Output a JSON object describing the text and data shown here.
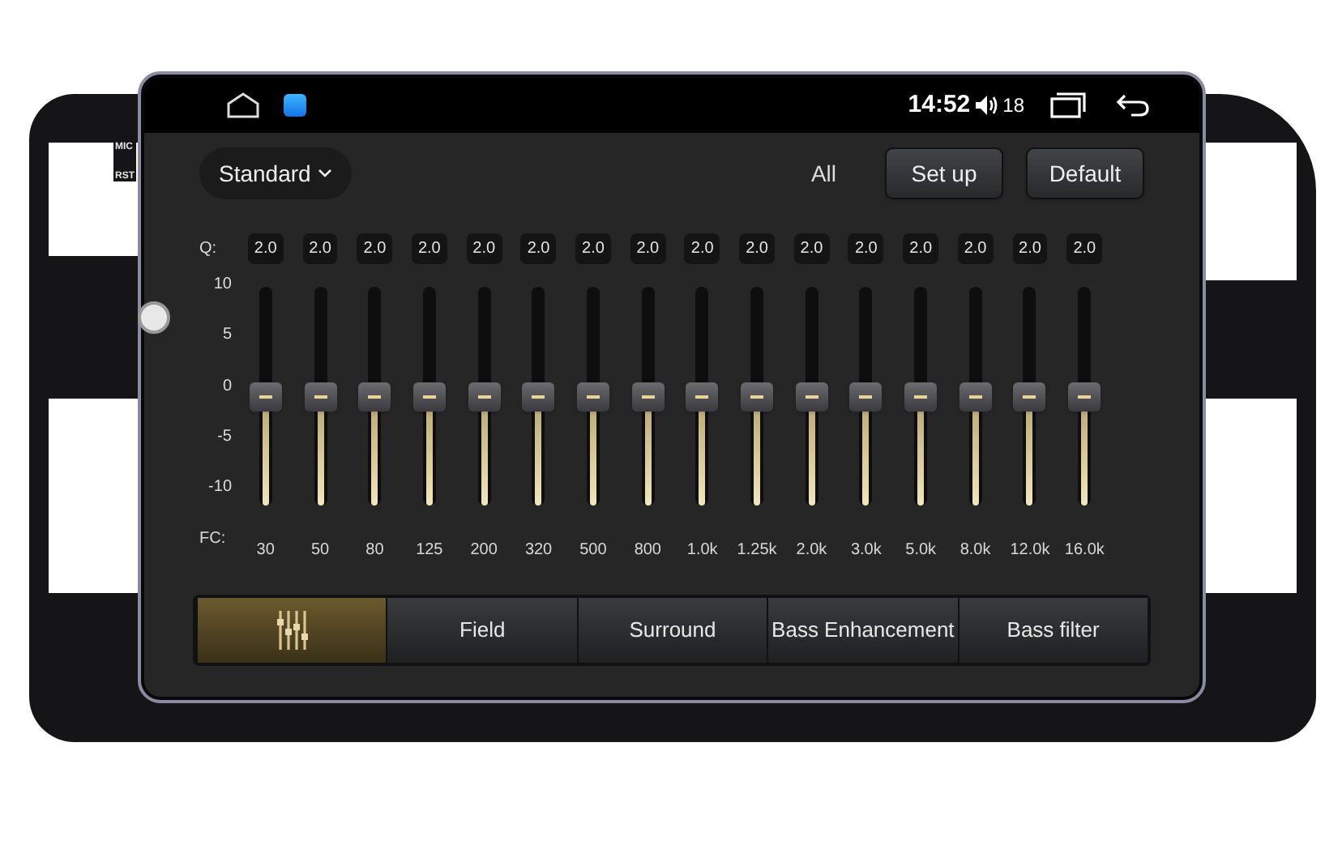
{
  "bezel": {
    "labels": [
      "MIC",
      "RST"
    ]
  },
  "status_bar": {
    "time": "14:52",
    "volume": "18"
  },
  "toolbar": {
    "preset": "Standard",
    "scope": "All",
    "buttons": [
      "Set up",
      "Default"
    ]
  },
  "equalizer": {
    "q_label": "Q:",
    "fc_label": "FC:",
    "scale": [
      "10",
      "5",
      "0",
      "-5",
      "-10"
    ],
    "bands": [
      {
        "q": "2.0",
        "fc": "30",
        "level": 0.5
      },
      {
        "q": "2.0",
        "fc": "50",
        "level": 0.5
      },
      {
        "q": "2.0",
        "fc": "80",
        "level": 0.5
      },
      {
        "q": "2.0",
        "fc": "125",
        "level": 0.5
      },
      {
        "q": "2.0",
        "fc": "200",
        "level": 0.5
      },
      {
        "q": "2.0",
        "fc": "320",
        "level": 0.5
      },
      {
        "q": "2.0",
        "fc": "500",
        "level": 0.5
      },
      {
        "q": "2.0",
        "fc": "800",
        "level": 0.5
      },
      {
        "q": "2.0",
        "fc": "1.0k",
        "level": 0.5
      },
      {
        "q": "2.0",
        "fc": "1.25k",
        "level": 0.5
      },
      {
        "q": "2.0",
        "fc": "2.0k",
        "level": 0.5
      },
      {
        "q": "2.0",
        "fc": "3.0k",
        "level": 0.5
      },
      {
        "q": "2.0",
        "fc": "5.0k",
        "level": 0.5
      },
      {
        "q": "2.0",
        "fc": "8.0k",
        "level": 0.5
      },
      {
        "q": "2.0",
        "fc": "12.0k",
        "level": 0.5
      },
      {
        "q": "2.0",
        "fc": "16.0k",
        "level": 0.5
      }
    ]
  },
  "tabs": [
    {
      "kind": "icon",
      "selected": true
    },
    {
      "kind": "text",
      "label": "Field",
      "selected": false
    },
    {
      "kind": "text",
      "label": "Surround",
      "selected": false
    },
    {
      "kind": "text",
      "label": "Bass Enhancement",
      "selected": false
    },
    {
      "kind": "text",
      "label": "Bass filter",
      "selected": false
    }
  ]
}
